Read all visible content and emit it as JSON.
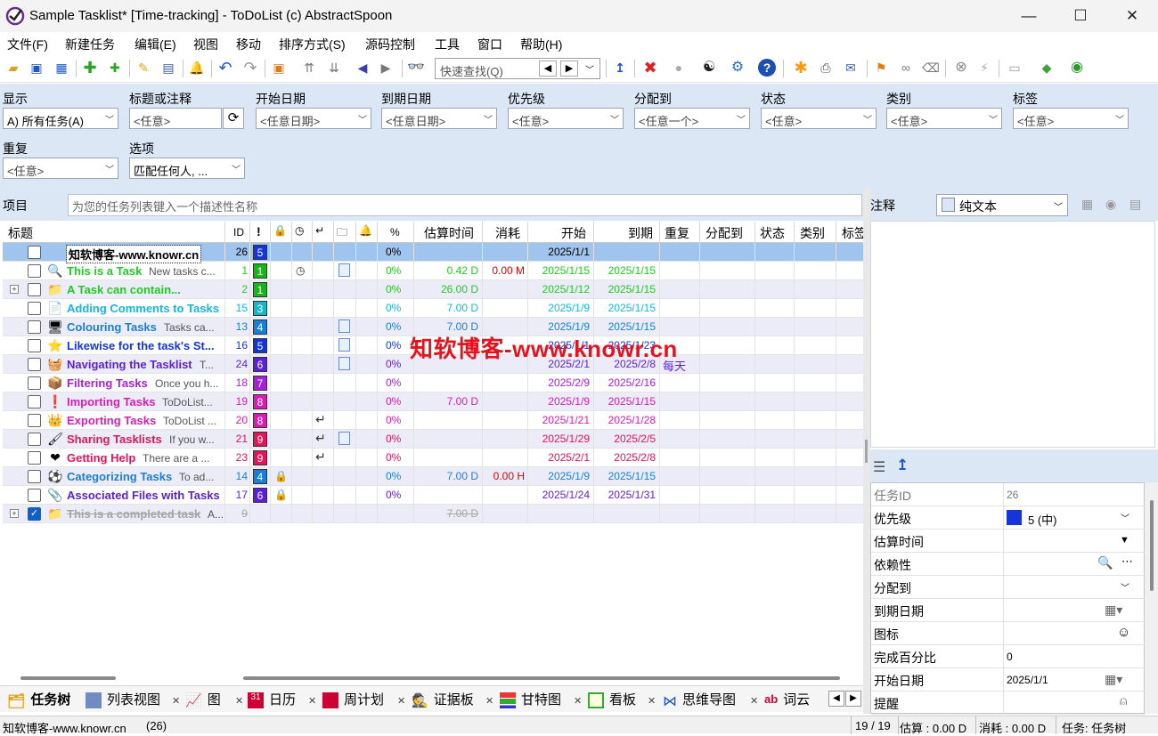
{
  "window": {
    "title": "Sample Tasklist* [Time-tracking] - ToDoList (c) AbstractSpoon",
    "minimize": "—",
    "maximize": "☐",
    "close": "✕"
  },
  "menu": [
    "文件(F)",
    "新建任务",
    "编辑(E)",
    "视图",
    "移动",
    "排序方式(S)",
    "源码控制",
    "工具",
    "窗口",
    "帮助(H)"
  ],
  "toolbar": {
    "quickfind_placeholder": "快速查找(Q)"
  },
  "filters": {
    "show_label": "显示",
    "show_value": "A) 所有任务(A)",
    "title_label": "标题或注释",
    "title_value": "<任意>",
    "start_label": "开始日期",
    "start_value": "<任意日期>",
    "due_label": "到期日期",
    "due_value": "<任意日期>",
    "priority_label": "优先级",
    "priority_value": "<任意>",
    "assigned_label": "分配到",
    "assigned_value": "<任意一个>",
    "status_label": "状态",
    "status_value": "<任意>",
    "category_label": "类别",
    "category_value": "<任意>",
    "tags_label": "标签",
    "tags_value": "<任意>",
    "recur_label": "重复",
    "recur_value": "<任意>",
    "options_label": "选项",
    "options_value": "匹配任何人, ..."
  },
  "project": {
    "label": "项目",
    "placeholder": "为您的任务列表键入一个描述性名称"
  },
  "columns": {
    "title": "标题",
    "id": "ID",
    "pct": "%",
    "est": "估算时间",
    "spent": "消耗",
    "start": "开始",
    "due": "到期",
    "recur": "重复",
    "assigned": "分配到",
    "status": "状态",
    "category": "类别",
    "tags": "标签"
  },
  "tasks": [
    {
      "title": "知软博客-www.knowr.cn",
      "comment": "",
      "id": "26",
      "pri": "5",
      "pcolor": "#1535d6",
      "pct": "0%",
      "est": "",
      "spent": "",
      "start": "2025/1/1",
      "due": "",
      "recur": "",
      "color": "#000",
      "icon": "",
      "icon_name": "",
      "checked": false,
      "expand": false,
      "tracked": false,
      "lock": false,
      "dep": false,
      "file": false,
      "sel": true
    },
    {
      "title": "This is a Task",
      "comment": "New tasks c...",
      "id": "1",
      "pri": "1",
      "pcolor": "#18b518",
      "pct": "0%",
      "est": "0.42 D",
      "spent": "0.00 M",
      "start": "2025/1/15",
      "due": "2025/1/15",
      "recur": "",
      "color": "#22c922",
      "icon": "🔍",
      "icon_name": "magnifier-icon",
      "checked": false,
      "expand": false,
      "tracked": true,
      "lock": false,
      "dep": false,
      "file": true
    },
    {
      "title": "A Task can contain...",
      "comment": "",
      "id": "2",
      "pri": "1",
      "pcolor": "#18b518",
      "pct": "0%",
      "est": "26.00 D",
      "spent": "",
      "start": "2025/1/12",
      "due": "2025/1/15",
      "recur": "",
      "color": "#22c922",
      "icon": "📁",
      "icon_name": "folder-icon",
      "checked": false,
      "expand": true,
      "tracked": false,
      "lock": false,
      "dep": false,
      "file": false
    },
    {
      "title": "Adding Comments to Tasks",
      "comment": "",
      "id": "15",
      "pri": "3",
      "pcolor": "#17b6c9",
      "pct": "0%",
      "est": "7.00 D",
      "spent": "",
      "start": "2025/1/9",
      "due": "2025/1/15",
      "recur": "",
      "color": "#17b6d9",
      "icon": "📄",
      "icon_name": "document-icon",
      "checked": false,
      "expand": false,
      "tracked": false,
      "lock": false,
      "dep": false,
      "file": false
    },
    {
      "title": "Colouring Tasks",
      "comment": "Tasks ca...",
      "id": "13",
      "pri": "4",
      "pcolor": "#1a7fd4",
      "pct": "0%",
      "est": "7.00 D",
      "spent": "",
      "start": "2025/1/9",
      "due": "2025/1/15",
      "recur": "",
      "color": "#1a7fd4",
      "icon": "🖥",
      "icon_name": "monitor-icon",
      "checked": false,
      "expand": false,
      "tracked": false,
      "lock": false,
      "dep": false,
      "file": true
    },
    {
      "title": "Likewise for the task's St...",
      "comment": "",
      "id": "16",
      "pri": "5",
      "pcolor": "#1535d6",
      "pct": "0%",
      "est": "",
      "spent": "",
      "start": "2025/1/1",
      "due": "2025/1/23",
      "recur": "",
      "color": "#1535d6",
      "icon": "⭐",
      "icon_name": "star-icon",
      "checked": false,
      "expand": false,
      "tracked": false,
      "lock": false,
      "dep": false,
      "file": true
    },
    {
      "title": "Navigating the Tasklist",
      "comment": "T...",
      "id": "24",
      "pri": "6",
      "pcolor": "#5a1fd6",
      "pct": "0%",
      "est": "",
      "spent": "",
      "start": "2025/2/1",
      "due": "2025/2/8",
      "recur": "每天",
      "color": "#5a1fd6",
      "icon": "🧺",
      "icon_name": "basket-icon",
      "checked": false,
      "expand": false,
      "tracked": false,
      "lock": false,
      "dep": false,
      "file": true
    },
    {
      "title": "Filtering Tasks",
      "comment": "Once you h...",
      "id": "18",
      "pri": "7",
      "pcolor": "#a322d6",
      "pct": "0%",
      "est": "",
      "spent": "",
      "start": "2025/2/9",
      "due": "2025/2/16",
      "recur": "",
      "color": "#a322d6",
      "icon": "📦",
      "icon_name": "box-icon",
      "checked": false,
      "expand": false,
      "tracked": false,
      "lock": false,
      "dep": false,
      "file": false
    },
    {
      "title": "Importing Tasks",
      "comment": "ToDoList...",
      "id": "19",
      "pri": "8",
      "pcolor": "#d61fb0",
      "pct": "0%",
      "est": "7.00 D",
      "spent": "",
      "start": "2025/1/9",
      "due": "2025/1/15",
      "recur": "",
      "color": "#d61fb0",
      "icon": "❗",
      "icon_name": "exclamation-icon",
      "checked": false,
      "expand": false,
      "tracked": false,
      "lock": false,
      "dep": false,
      "file": false
    },
    {
      "title": "Exporting Tasks",
      "comment": "ToDoList ...",
      "id": "20",
      "pri": "8",
      "pcolor": "#d61fb0",
      "pct": "0%",
      "est": "",
      "spent": "",
      "start": "2025/1/21",
      "due": "2025/1/28",
      "recur": "",
      "color": "#d61fb0",
      "icon": "👑",
      "icon_name": "crown-icon",
      "checked": false,
      "expand": false,
      "tracked": false,
      "lock": false,
      "dep": true,
      "file": false
    },
    {
      "title": "Sharing Tasklists",
      "comment": "If you w...",
      "id": "21",
      "pri": "9",
      "pcolor": "#e0155a",
      "pct": "0%",
      "est": "",
      "spent": "",
      "start": "2025/1/29",
      "due": "2025/2/5",
      "recur": "",
      "color": "#e0155a",
      "icon": "🖌",
      "icon_name": "brush-icon",
      "checked": false,
      "expand": false,
      "tracked": false,
      "lock": false,
      "dep": true,
      "file": true
    },
    {
      "title": "Getting Help",
      "comment": "There are a ...",
      "id": "23",
      "pri": "9",
      "pcolor": "#e0155a",
      "pct": "0%",
      "est": "",
      "spent": "",
      "start": "2025/2/1",
      "due": "2025/2/8",
      "recur": "",
      "color": "#e0155a",
      "icon": "❤",
      "icon_name": "heart-icon",
      "checked": false,
      "expand": false,
      "tracked": false,
      "lock": false,
      "dep": true,
      "file": false
    },
    {
      "title": "Categorizing Tasks",
      "comment": "To ad...",
      "id": "14",
      "pri": "4",
      "pcolor": "#1a7fd4",
      "pct": "0%",
      "est": "7.00 D",
      "spent": "0.00 H",
      "start": "2025/1/9",
      "due": "2025/1/15",
      "recur": "",
      "color": "#1a7fd4",
      "icon": "⚽",
      "icon_name": "soccer-ball-icon",
      "checked": false,
      "expand": false,
      "tracked": false,
      "lock": true,
      "dep": false,
      "file": false
    },
    {
      "title": "Associated Files with Tasks",
      "comment": "",
      "id": "17",
      "pri": "6",
      "pcolor": "#5a1fd6",
      "pct": "0%",
      "est": "",
      "spent": "",
      "start": "2025/1/24",
      "due": "2025/1/31",
      "recur": "",
      "color": "#5a1fd6",
      "icon": "📎",
      "icon_name": "paperclip-icon",
      "checked": false,
      "expand": false,
      "tracked": false,
      "lock": true,
      "dep": false,
      "file": false
    },
    {
      "title": "This is a completed task",
      "comment": "A...",
      "id": "9",
      "pri": "",
      "pcolor": "",
      "pct": "",
      "est": "7.00 D",
      "spent": "",
      "start": "",
      "due": "",
      "recur": "",
      "color": "#a6a6a6",
      "icon": "📁",
      "icon_name": "folder-icon",
      "checked": true,
      "expand": true,
      "tracked": false,
      "lock": false,
      "dep": false,
      "file": false,
      "done": true
    }
  ],
  "watermark": "知软博客-www.knowr.cn",
  "view_tabs": [
    "任务树",
    "列表视图",
    "图",
    "日历",
    "周计划",
    "证据板",
    "甘特图",
    "看板",
    "思维导图",
    "词云"
  ],
  "notes": {
    "label": "注释",
    "format": "纯文本"
  },
  "properties": [
    {
      "label": "任务ID",
      "value": "26",
      "type": "ro"
    },
    {
      "label": "优先级",
      "value": "5 (中)",
      "type": "prio",
      "swatch": "#1535d6"
    },
    {
      "label": "估算时间",
      "value": "",
      "type": "dd"
    },
    {
      "label": "依赖性",
      "value": "",
      "type": "search"
    },
    {
      "label": "分配到",
      "value": "",
      "type": "dd2"
    },
    {
      "label": "到期日期",
      "value": "",
      "type": "date"
    },
    {
      "label": "图标",
      "value": "",
      "type": "smile"
    },
    {
      "label": "完成百分比",
      "value": "0",
      "type": "text"
    },
    {
      "label": "开始日期",
      "value": "2025/1/1",
      "type": "date"
    },
    {
      "label": "提醒",
      "value": "",
      "type": "bell"
    }
  ],
  "statusbar": {
    "left": "知软博客-www.knowr.cn",
    "count": "(26)",
    "ratio": "19 / 19",
    "est": "估算 : 0.00 D",
    "spent": "消耗 : 0.00 D",
    "view": "任务: 任务树"
  }
}
